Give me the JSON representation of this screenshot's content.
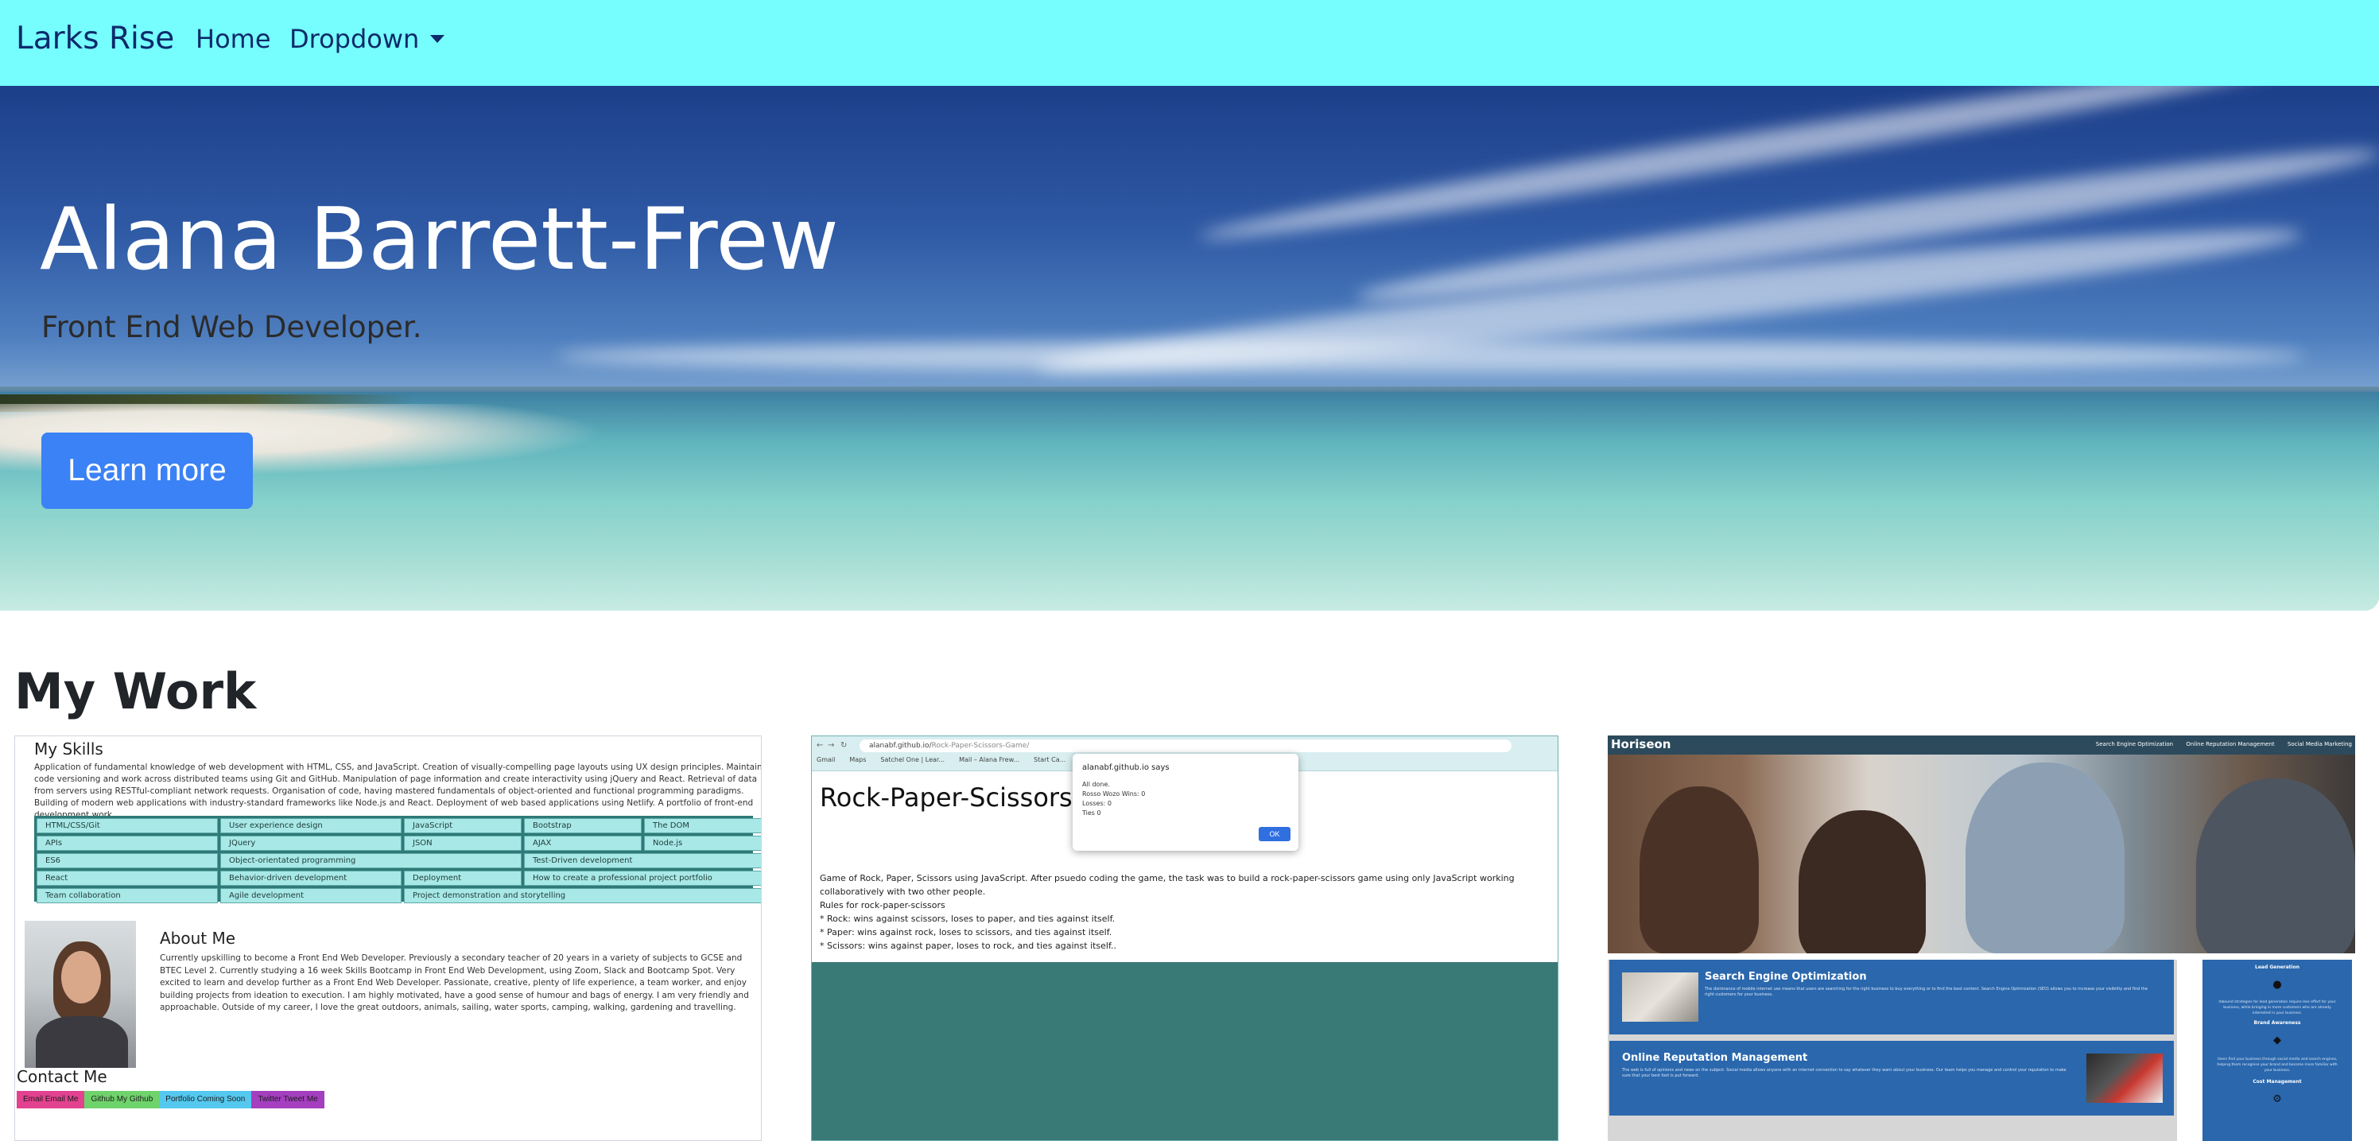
{
  "navbar": {
    "brand": "Larks Rise",
    "home": "Home",
    "dropdown": "Dropdown"
  },
  "hero": {
    "title": "Alana Barrett-Frew",
    "lead": "Front End Web Developer.",
    "button": "Learn more"
  },
  "section_title": "My Work",
  "cards": {
    "skills": {
      "heading": "My Skills",
      "intro": "Application of fundamental knowledge of web development with HTML, CSS, and JavaScript. Creation of visually-compelling page layouts using UX design principles. Maintain code versioning and work across distributed teams using Git and GitHub. Manipulation of page information and create interactivity using jQuery and React. Retrieval of data from servers using RESTful-compliant network requests. Organisation of code, having mastered fundamentals of object-oriented and functional programming paradigms. Building of modern web applications with industry-standard frameworks like Node.js and React. Deployment of web based applications using Netlify. A portfolio of front-end development work.",
      "skills": [
        "HTML/CSS/Git",
        "User experience design",
        "JavaScript",
        "Bootstrap",
        "The DOM",
        "APIs",
        "JQuery",
        "JSON",
        "AJAX",
        "Node.js",
        "ES6",
        "Object-orientated programming",
        "Test-Driven development",
        "React",
        "Behavior-driven development",
        "Deployment",
        "How to create a professional project portfolio",
        "Team collaboration",
        "Agile development",
        "Project demonstration and storytelling"
      ],
      "about_heading": "About Me",
      "about_text": "Currently upskilling to become a Front End Web Developer. Previously a secondary teacher of 20 years in a variety of subjects to GCSE and BTEC Level 2. Currently studying a 16 week Skills Bootcamp in Front End Web Development, using Zoom, Slack and Bootcamp Spot. Very excited to learn and develop further as a Front End Web Developer. Passionate, creative, plenty of life experience, a team worker, and enjoy building projects from ideation to execution. I am highly motivated, have a good sense of humour and bags of energy. I am very friendly and approachable. Outside of my career, I love the great outdoors, animals, sailing, water sports, camping, walking, gardening and travelling.",
      "contact_heading": "Contact Me",
      "contact_buttons": [
        {
          "label": "Email Email Me",
          "color": "#e2428f"
        },
        {
          "label": "Github My Github",
          "color": "#6fd36b"
        },
        {
          "label": "Portfolio Coming Soon",
          "color": "#54c8ee"
        },
        {
          "label": "Twitter Tweet Me",
          "color": "#a43fbf"
        }
      ]
    },
    "rps": {
      "url_host": "alanabf.github.io/",
      "url_path": "Rock-Paper-Scissors-Game/",
      "bookmarks": [
        "Gmail",
        "Maps",
        "Satchel One | Lear...",
        "Mail – Alana Frew...",
        "Start Ca..."
      ],
      "title": "Rock-Paper-Scissors",
      "alert_title": "alanabf.github.io says",
      "alert_lines": [
        "All done.",
        "Rosso Wozo Wins: 0",
        "Losses: 0",
        "Ties 0"
      ],
      "alert_ok": "OK",
      "description": "Game of Rock, Paper, Scissors using JavaScript. After psuedo coding the game, the task was to build a rock-paper-scissors game using only JavaScript working collaboratively with two other people.",
      "rules_heading": "Rules for rock-paper-scissors",
      "rules": [
        "* Rock: wins against scissors, loses to paper, and ties against itself.",
        "* Paper: wins against rock, loses to scissors, and ties against itself.",
        "* Scissors: wins against paper, loses to rock, and ties against itself.."
      ]
    },
    "horiseon": {
      "logo": "Horiseon",
      "links": [
        "Search Engine Optimization",
        "Online Reputation Management",
        "Social Media Marketing"
      ],
      "panels": [
        {
          "title": "Search Engine Optimization",
          "text": "The dominance of mobile internet use means that users are searching for the right business to buy everything or to find the best content. Search Engine Optimization (SEO) allows you to increase your visibility and find the right customers for your business."
        },
        {
          "title": "Online Reputation Management",
          "text": "The web is full of opinions and news on the subject. Social media allows anyone with an internet connection to say whatever they want about your business. Our team helps you manage and control your reputation to make sure that your best foot is put forward."
        }
      ],
      "aside": [
        {
          "title": "Lead Generation",
          "icon": "lightbulb-icon",
          "text": "Inbound strategies for lead generation require less effort for your business, while bringing in more customers who are already interested in your business."
        },
        {
          "title": "Brand Awareness",
          "icon": "brand-icon",
          "text": "Users find your business through social media and search engines, helping them recognise your brand and become more familiar with your business."
        },
        {
          "title": "Cost Management",
          "icon": "cost-icon",
          "text": ""
        }
      ]
    }
  },
  "colors": {
    "navbar": "#76fdfd",
    "button": "#3b82f6",
    "teal": "#397a77",
    "horiseon_blue": "#2a67ad"
  }
}
